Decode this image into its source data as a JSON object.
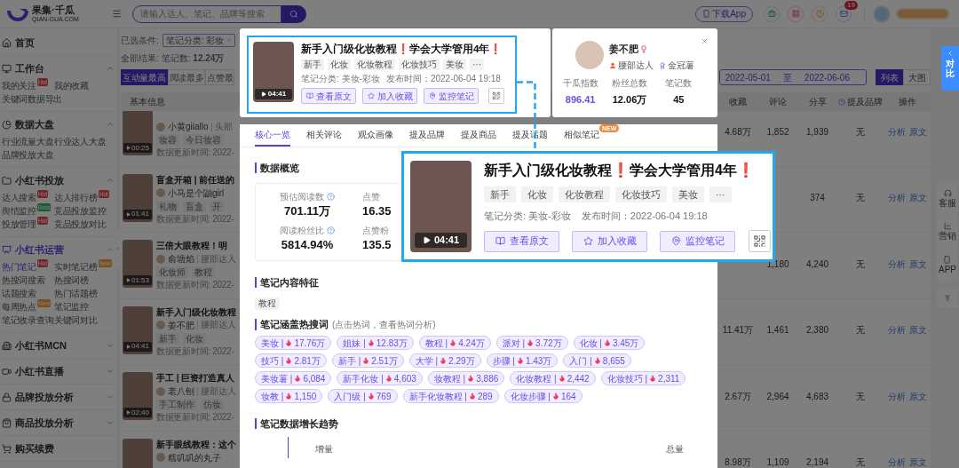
{
  "header": {
    "logo": {
      "name": "果集·千瓜",
      "domain": "QIAN-GUA.COM"
    },
    "search": {
      "placeholder": "请输入达人、笔记、品牌等搜索"
    },
    "download_button": "下载App",
    "mail_badge": "19"
  },
  "sidebar": {
    "sections": [
      {
        "label": "首页",
        "selected": false
      },
      {
        "label": "工作台",
        "selected": false,
        "expanded": true,
        "items": [
          {
            "label": "我的关注",
            "selected": false,
            "badge": {
              "text": "Hot",
              "kind": "hot"
            }
          },
          {
            "label": "我的收藏",
            "selected": false
          },
          {
            "label": "关键词数据导出",
            "selected": false
          }
        ]
      },
      {
        "label": "数据大盘",
        "selected": false,
        "expanded": true,
        "items": [
          {
            "label": "行业流量大盘",
            "selected": false
          },
          {
            "label": "行业达人大盘",
            "selected": false
          },
          {
            "label": "品牌投放大盘",
            "selected": false
          }
        ]
      },
      {
        "label": "小红书投放",
        "selected": false,
        "expanded": true,
        "items": [
          {
            "label": "达人搜索",
            "selected": false,
            "badge": {
              "text": "Hot",
              "kind": "hot"
            }
          },
          {
            "label": "达人排行榜",
            "selected": false,
            "badge": {
              "text": "Hot",
              "kind": "hot"
            }
          },
          {
            "label": "舆情监控",
            "selected": false,
            "badge": {
              "text": "Beta",
              "kind": "beta"
            }
          },
          {
            "label": "竞品投放监控",
            "selected": false
          },
          {
            "label": "投放管理",
            "selected": false,
            "badge": {
              "text": "Hot",
              "kind": "hot"
            }
          },
          {
            "label": "竞品投放对比",
            "selected": false
          }
        ]
      },
      {
        "label": "小红书运营",
        "selected": true,
        "expanded": true,
        "items": [
          {
            "label": "热门笔记",
            "selected": true,
            "badge": {
              "text": "Hot",
              "kind": "hot"
            }
          },
          {
            "label": "实时笔记榜",
            "selected": false,
            "badge": {
              "text": "New",
              "kind": "new"
            }
          },
          {
            "label": "热搜词搜索",
            "selected": false
          },
          {
            "label": "热搜词榜",
            "selected": false
          },
          {
            "label": "话题搜索",
            "selected": false
          },
          {
            "label": "热门话题榜",
            "selected": false
          },
          {
            "label": "每周热点",
            "selected": false,
            "badge": {
              "text": "New",
              "kind": "new"
            }
          },
          {
            "label": "笔记监控",
            "selected": false
          },
          {
            "label": "笔记收录查询",
            "selected": false
          },
          {
            "label": "关键词对比",
            "selected": false
          }
        ]
      },
      {
        "label": "小红书MCN",
        "selected": false,
        "expanded": false
      },
      {
        "label": "小红书直播",
        "selected": false,
        "expanded": false
      },
      {
        "label": "品牌投放分析",
        "selected": false,
        "expanded": false
      },
      {
        "label": "商品投放分析",
        "selected": false,
        "expanded": false
      },
      {
        "label": "购买续费",
        "selected": false
      }
    ]
  },
  "filters": {
    "label": "已选条件:",
    "chip": "笔记分类: 彩妆",
    "results_label": "全部结果:",
    "results_value": "笔记数: **12.24万**"
  },
  "sort_tabs": [
    {
      "label": "互动量最高",
      "selected": true
    },
    {
      "label": "阅读最多",
      "selected": false
    },
    {
      "label": "点赞最",
      "selected": false
    }
  ],
  "date_range": {
    "start": "2022-05-01",
    "separator": "至",
    "end": "2022-06-06"
  },
  "view_toggle": [
    {
      "label": "列表",
      "selected": true
    },
    {
      "label": "大图",
      "selected": false
    }
  ],
  "table": {
    "columns": [
      "基本信息",
      "收藏",
      "评论",
      "分享",
      "提及品牌",
      "操作"
    ],
    "rows": [
      {
        "author": "小黄giiallo",
        "level": "头部",
        "tags": [
          "妆容",
          "今日妆容"
        ],
        "updated": "数据更新时间: 2022-",
        "duration": "00:25",
        "favorites": "4.68万",
        "comments": "1,852",
        "shares": "1,939",
        "brand": "无",
        "actions": [
          "分析",
          "原文"
        ]
      },
      {
        "title": "盲盒开箱 | 前任送的",
        "author": "小马是个鼬girl",
        "tags": [
          "礼物",
          "盲盒",
          "开"
        ],
        "updated": "数据更新时间: 2022-",
        "duration": "01:41",
        "shares": "374",
        "brand": "无",
        "actions": [
          "分析",
          "原文"
        ]
      },
      {
        "title": "三倍大眼教程！明",
        "author": "俞塘焰",
        "level": "腰部达人",
        "tags": [
          "化妆师",
          "教程"
        ],
        "updated": "数据更新时间: 2022-",
        "duration": "01:53",
        "comments": "1,180",
        "shares": "4,240",
        "brand": "无",
        "actions": [
          "分析",
          "原文"
        ]
      },
      {
        "title": "新手入门级化妆教程",
        "author": "姜不肥",
        "level": "腰部达人",
        "tags": [
          "新手",
          "化妆"
        ],
        "updated": "数据更新时间: 2022-",
        "duration": "04:41",
        "favorites": "11.41万",
        "comments": "1,461",
        "shares": "2,380",
        "brand": "无",
        "actions": [
          "分析",
          "原文"
        ]
      },
      {
        "title": "手工 | 巨资打造真人",
        "author": "老八刨",
        "level": "腰部达人",
        "tags": [
          "手工制作",
          "仿妆"
        ],
        "updated": "数据更新时间: 2022-",
        "duration": "02:40",
        "favorites": "2.67万",
        "comments": "2,964",
        "shares": "4,683",
        "brand": "无",
        "actions": [
          "分析",
          "原文"
        ]
      },
      {
        "title": "新手眼线教程：这个",
        "author": "糯叽叽的丸子",
        "favorites": "8.98万",
        "comments": "1,109",
        "shares": "2,194",
        "brand": "无",
        "actions": [
          "分析",
          "原文"
        ]
      }
    ]
  },
  "note_card": {
    "duration": "04:41",
    "title": "新手入门级化妆教程❗学会大学管用4年❗",
    "tags": [
      "新手",
      "化妆",
      "化妆教程",
      "化妆技巧",
      "美妆",
      "···"
    ],
    "category": "笔记分类: 美妆-彩妆",
    "published": "发布时间：2022-06-04 19:18",
    "buttons": [
      "查看原文",
      "加入收藏",
      "监控笔记"
    ]
  },
  "note_callout": {
    "duration": "04:41",
    "title": "新手入门级化妆教程❗学会大学管用4年❗",
    "tags": [
      "新手",
      "化妆",
      "化妆教程",
      "化妆技巧",
      "美妆",
      "···"
    ],
    "category": "笔记分类: 美妆-彩妆",
    "published": "发布时间：2022-06-04 19:18",
    "buttons": [
      "查看原文",
      "加入收藏",
      "监控笔记"
    ]
  },
  "profile": {
    "name": "姜不肥",
    "badges": [
      "腰部达人",
      "金冠薯"
    ],
    "stats": [
      {
        "label": "千瓜指数",
        "value": "896.41"
      },
      {
        "label": "粉丝总数",
        "value": "12.06万"
      },
      {
        "label": "笔记数",
        "value": "45"
      }
    ]
  },
  "detail_tabs": [
    {
      "label": "核心一览",
      "selected": true
    },
    {
      "label": "相关评论",
      "selected": false
    },
    {
      "label": "观众画像",
      "selected": false
    },
    {
      "label": "提及品牌",
      "selected": false
    },
    {
      "label": "提及商品",
      "selected": false
    },
    {
      "label": "提及话题",
      "selected": false
    },
    {
      "label": "相似笔记",
      "selected": false,
      "badge": "NEW"
    }
  ],
  "overview": {
    "title": "数据概览",
    "metrics": [
      {
        "label": "预估阅读数",
        "value": "701.11万",
        "help": true
      },
      {
        "label": "点赞",
        "value": "16.35",
        "help": false
      },
      {
        "label": "阅读粉丝比",
        "value": "5814.94%",
        "help": true
      },
      {
        "label": "点赞粉",
        "value": "135.5",
        "help": false
      }
    ]
  },
  "content_features": {
    "title": "笔记内容特征",
    "tags": [
      "教程"
    ]
  },
  "hot_keywords": {
    "title": "笔记涵盖热搜词",
    "hint": "(点击热词，查看热词分析)",
    "keywords": [
      {
        "keyword": "美妆 |",
        "count": "17.76万"
      },
      {
        "keyword": "姐妹 |",
        "count": "12.83万"
      },
      {
        "keyword": "教程 |",
        "count": "4.24万"
      },
      {
        "keyword": "派对 |",
        "count": "3.72万"
      },
      {
        "keyword": "化妆 |",
        "count": "3.45万"
      },
      {
        "keyword": "技巧 |",
        "count": "2.81万"
      },
      {
        "keyword": "新手 |",
        "count": "2.51万"
      },
      {
        "keyword": "大学 |",
        "count": "2.29万"
      },
      {
        "keyword": "步骤 |",
        "count": "1.43万"
      },
      {
        "keyword": "入门 |",
        "count": "8,655"
      },
      {
        "keyword": "美妆薯 |",
        "count": "6,084"
      },
      {
        "keyword": "新手化妆 |",
        "count": "4,603"
      },
      {
        "keyword": "妆教程 |",
        "count": "3,886"
      },
      {
        "keyword": "化妆教程 |",
        "count": "2,442"
      },
      {
        "keyword": "化妆技巧 |",
        "count": "2,311"
      },
      {
        "keyword": "妆教 |",
        "count": "1,150"
      },
      {
        "keyword": "入门级 |",
        "count": "769"
      },
      {
        "keyword": "新手化妆教程 |",
        "count": "289"
      },
      {
        "keyword": "化妆步骤 |",
        "count": "164"
      }
    ]
  },
  "growth": {
    "title": "笔记数据增长趋势",
    "left_label": "增量",
    "right_label": "总量"
  },
  "compare_tab": {
    "label": "对比"
  },
  "side_tools": [
    "客服",
    "营销",
    "APP"
  ]
}
